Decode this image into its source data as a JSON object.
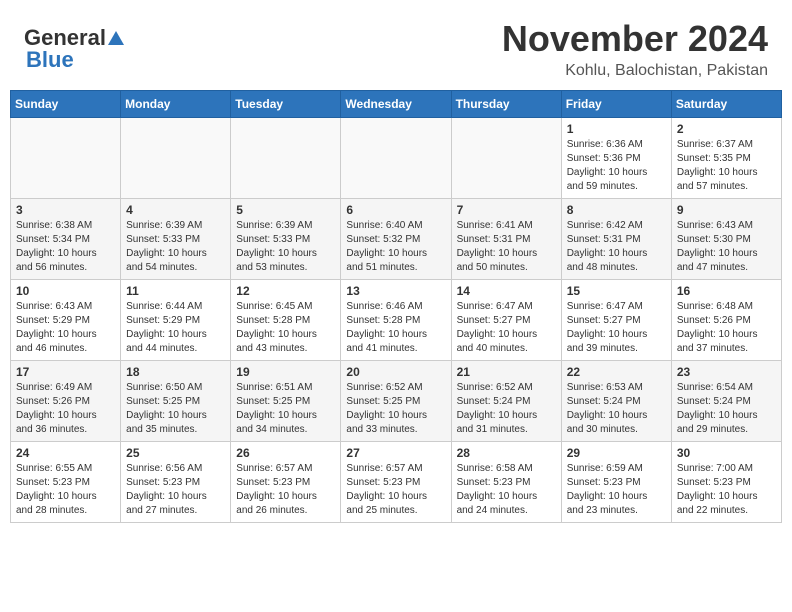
{
  "header": {
    "logo_general": "General",
    "logo_blue": "Blue",
    "month": "November 2024",
    "location": "Kohlu, Balochistan, Pakistan"
  },
  "days_of_week": [
    "Sunday",
    "Monday",
    "Tuesday",
    "Wednesday",
    "Thursday",
    "Friday",
    "Saturday"
  ],
  "weeks": [
    [
      {
        "day": "",
        "info": ""
      },
      {
        "day": "",
        "info": ""
      },
      {
        "day": "",
        "info": ""
      },
      {
        "day": "",
        "info": ""
      },
      {
        "day": "",
        "info": ""
      },
      {
        "day": "1",
        "info": "Sunrise: 6:36 AM\nSunset: 5:36 PM\nDaylight: 10 hours and 59 minutes."
      },
      {
        "day": "2",
        "info": "Sunrise: 6:37 AM\nSunset: 5:35 PM\nDaylight: 10 hours and 57 minutes."
      }
    ],
    [
      {
        "day": "3",
        "info": "Sunrise: 6:38 AM\nSunset: 5:34 PM\nDaylight: 10 hours and 56 minutes."
      },
      {
        "day": "4",
        "info": "Sunrise: 6:39 AM\nSunset: 5:33 PM\nDaylight: 10 hours and 54 minutes."
      },
      {
        "day": "5",
        "info": "Sunrise: 6:39 AM\nSunset: 5:33 PM\nDaylight: 10 hours and 53 minutes."
      },
      {
        "day": "6",
        "info": "Sunrise: 6:40 AM\nSunset: 5:32 PM\nDaylight: 10 hours and 51 minutes."
      },
      {
        "day": "7",
        "info": "Sunrise: 6:41 AM\nSunset: 5:31 PM\nDaylight: 10 hours and 50 minutes."
      },
      {
        "day": "8",
        "info": "Sunrise: 6:42 AM\nSunset: 5:31 PM\nDaylight: 10 hours and 48 minutes."
      },
      {
        "day": "9",
        "info": "Sunrise: 6:43 AM\nSunset: 5:30 PM\nDaylight: 10 hours and 47 minutes."
      }
    ],
    [
      {
        "day": "10",
        "info": "Sunrise: 6:43 AM\nSunset: 5:29 PM\nDaylight: 10 hours and 46 minutes."
      },
      {
        "day": "11",
        "info": "Sunrise: 6:44 AM\nSunset: 5:29 PM\nDaylight: 10 hours and 44 minutes."
      },
      {
        "day": "12",
        "info": "Sunrise: 6:45 AM\nSunset: 5:28 PM\nDaylight: 10 hours and 43 minutes."
      },
      {
        "day": "13",
        "info": "Sunrise: 6:46 AM\nSunset: 5:28 PM\nDaylight: 10 hours and 41 minutes."
      },
      {
        "day": "14",
        "info": "Sunrise: 6:47 AM\nSunset: 5:27 PM\nDaylight: 10 hours and 40 minutes."
      },
      {
        "day": "15",
        "info": "Sunrise: 6:47 AM\nSunset: 5:27 PM\nDaylight: 10 hours and 39 minutes."
      },
      {
        "day": "16",
        "info": "Sunrise: 6:48 AM\nSunset: 5:26 PM\nDaylight: 10 hours and 37 minutes."
      }
    ],
    [
      {
        "day": "17",
        "info": "Sunrise: 6:49 AM\nSunset: 5:26 PM\nDaylight: 10 hours and 36 minutes."
      },
      {
        "day": "18",
        "info": "Sunrise: 6:50 AM\nSunset: 5:25 PM\nDaylight: 10 hours and 35 minutes."
      },
      {
        "day": "19",
        "info": "Sunrise: 6:51 AM\nSunset: 5:25 PM\nDaylight: 10 hours and 34 minutes."
      },
      {
        "day": "20",
        "info": "Sunrise: 6:52 AM\nSunset: 5:25 PM\nDaylight: 10 hours and 33 minutes."
      },
      {
        "day": "21",
        "info": "Sunrise: 6:52 AM\nSunset: 5:24 PM\nDaylight: 10 hours and 31 minutes."
      },
      {
        "day": "22",
        "info": "Sunrise: 6:53 AM\nSunset: 5:24 PM\nDaylight: 10 hours and 30 minutes."
      },
      {
        "day": "23",
        "info": "Sunrise: 6:54 AM\nSunset: 5:24 PM\nDaylight: 10 hours and 29 minutes."
      }
    ],
    [
      {
        "day": "24",
        "info": "Sunrise: 6:55 AM\nSunset: 5:23 PM\nDaylight: 10 hours and 28 minutes."
      },
      {
        "day": "25",
        "info": "Sunrise: 6:56 AM\nSunset: 5:23 PM\nDaylight: 10 hours and 27 minutes."
      },
      {
        "day": "26",
        "info": "Sunrise: 6:57 AM\nSunset: 5:23 PM\nDaylight: 10 hours and 26 minutes."
      },
      {
        "day": "27",
        "info": "Sunrise: 6:57 AM\nSunset: 5:23 PM\nDaylight: 10 hours and 25 minutes."
      },
      {
        "day": "28",
        "info": "Sunrise: 6:58 AM\nSunset: 5:23 PM\nDaylight: 10 hours and 24 minutes."
      },
      {
        "day": "29",
        "info": "Sunrise: 6:59 AM\nSunset: 5:23 PM\nDaylight: 10 hours and 23 minutes."
      },
      {
        "day": "30",
        "info": "Sunrise: 7:00 AM\nSunset: 5:23 PM\nDaylight: 10 hours and 22 minutes."
      }
    ]
  ]
}
